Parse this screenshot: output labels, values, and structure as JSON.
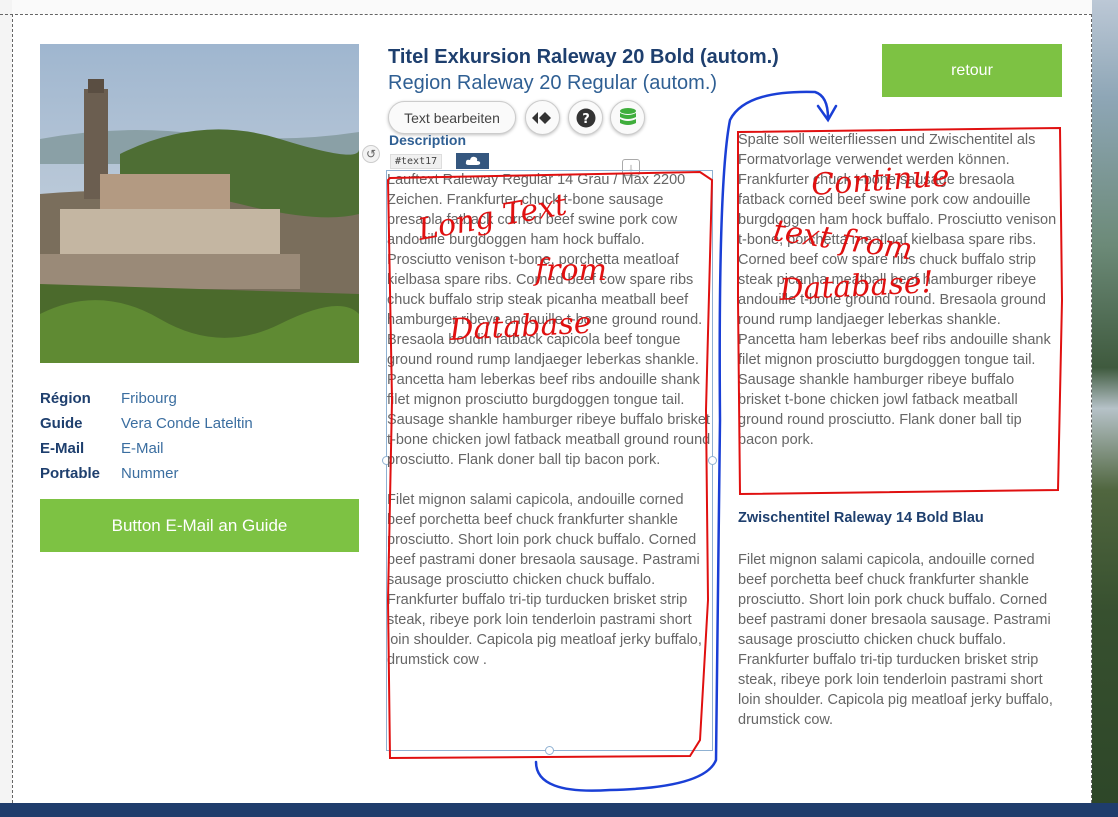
{
  "header": {
    "title": "Titel Exkursion Raleway 20 Bold (autom.)",
    "subtitle": "Region Raleway 20 Regular (autom.)",
    "retour_label": "retour"
  },
  "toolbar": {
    "text_edit_label": "Text bearbeiten",
    "icons": [
      "diamond-arrows-icon",
      "help-icon",
      "database-icon"
    ]
  },
  "editor": {
    "description_label": "Description",
    "tag": "#text17",
    "cloud_icon": "cloud-icon"
  },
  "info": [
    {
      "label": "Région",
      "value": "Fribourg"
    },
    {
      "label": "Guide",
      "value": "Vera Conde Lateltin"
    },
    {
      "label": "E-Mail",
      "value": "E-Mail"
    },
    {
      "label": "Portable",
      "value": "Nummer"
    }
  ],
  "guide_button_label": "Button E-Mail an Guide",
  "content": {
    "col1_p1": "Lauftext Raleway Regular 14 Grau / Max 2200 Zeichen. Frankfurter chuck t-bone sausage bresaola fatback corned beef swine pork cow andouille burgdoggen ham hock buffalo. Prosciutto venison t-bone, porchetta meatloaf kielbasa spare ribs. Corned beef cow spare ribs chuck buffalo strip steak picanha meatball beef hamburger ribeye andouille t-bone ground round. Bresaola boudin fatback capicola beef tongue ground round rump landjaeger leberkas shankle. Pancetta ham leberkas beef ribs andouille shank filet mignon prosciutto burgdoggen tongue tail. Sausage shankle hamburger ribeye buffalo brisket t-bone chicken jowl fatback meatball ground round prosciutto. Flank doner ball tip bacon pork.",
    "col1_p2": "Filet mignon salami capicola, andouille corned beef porchetta beef chuck frankfurter shankle prosciutto. Short loin pork chuck buffalo. Corned beef pastrami doner bresaola sausage. Pastrami sausage prosciutto chicken chuck buffalo. Frankfurter buffalo tri-tip turducken brisket strip steak, ribeye pork loin tenderloin pastrami short loin shoulder. Capicola pig meatloaf jerky buffalo, drumstick cow .",
    "col2_p1": "Spalte soll weiterfliessen und Zwischentitel als Formatvorlage verwendet werden können. Frankfurter chuck t-bone sausage bresaola fatback corned beef swine pork cow andouille burgdoggen ham hock buffalo. Prosciutto venison t-bone, porchetta meatloaf kielbasa spare ribs. Corned beef cow spare ribs chuck buffalo strip steak picanha meatball beef hamburger ribeye andouille t-bone ground round. Bresaola ground round rump landjaeger leberkas shankle. Pancetta ham leberkas beef ribs andouille shank filet mignon prosciutto burgdoggen tongue tail. Sausage shankle hamburger ribeye buffalo brisket t-bone chicken jowl fatback meatball ground round prosciutto. Flank doner ball tip bacon pork.",
    "subheading": "Zwischentitel Raleway 14 Bold Blau",
    "col3_p1": "Filet mignon salami capicola, andouille corned beef porchetta beef chuck frankfurter shankle prosciutto. Short loin pork chuck buffalo. Corned beef pastrami doner bresaola sausage. Pastrami sausage prosciutto chicken chuck buffalo. Frankfurter buffalo tri-tip turducken brisket strip steak, ribeye pork loin tenderloin pastrami short loin shoulder. Capicola pig meatloaf jerky buffalo, drumstick cow."
  },
  "annotations": {
    "note1_line1": "Long Text",
    "note1_line2": "from",
    "note1_line3": "Database",
    "note2_line1": "Continue",
    "note2_line2": "text from",
    "note2_line3": "Database!",
    "ink_red": "#e01010",
    "ink_blue": "#1a3fd6"
  },
  "colors": {
    "accent_green": "#7dc243",
    "title_blue": "#1e3f6e",
    "link_blue": "#3b6ea0"
  }
}
